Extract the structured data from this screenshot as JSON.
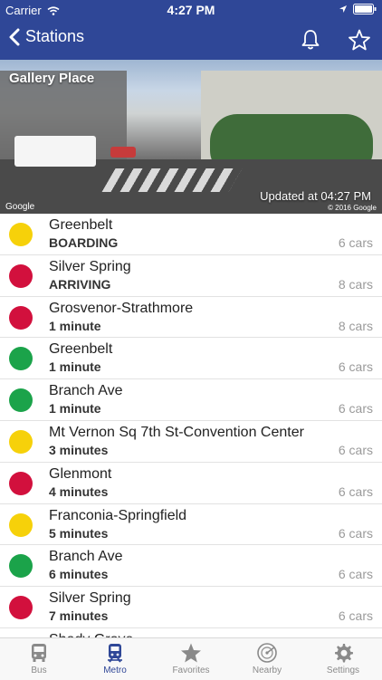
{
  "status_bar": {
    "carrier": "Carrier",
    "time": "4:27 PM",
    "location_icon": "location-arrow-icon",
    "battery_icon": "battery-icon",
    "wifi_icon": "wifi-icon"
  },
  "nav": {
    "back_label": "Stations",
    "back_icon": "chevron-left-icon",
    "bell_icon": "bell-icon",
    "star_icon": "star-icon",
    "bar_color": "#2f4797"
  },
  "banner": {
    "station": "Gallery Place",
    "updated": "Updated at 04:27 PM",
    "google": "Google",
    "copyright": "© 2016 Google"
  },
  "colors": {
    "yellow": "#f6d10a",
    "red": "#d2103d",
    "green": "#1ba34a"
  },
  "arrivals": [
    {
      "destination": "Greenbelt",
      "eta": "BOARDING",
      "cars": "6 cars",
      "line_color": "#f6d10a"
    },
    {
      "destination": "Silver Spring",
      "eta": "ARRIVING",
      "cars": "8 cars",
      "line_color": "#d2103d"
    },
    {
      "destination": "Grosvenor-Strathmore",
      "eta": "1 minute",
      "cars": "8 cars",
      "line_color": "#d2103d"
    },
    {
      "destination": "Greenbelt",
      "eta": "1 minute",
      "cars": "6 cars",
      "line_color": "#1ba34a"
    },
    {
      "destination": "Branch Ave",
      "eta": "1 minute",
      "cars": "6 cars",
      "line_color": "#1ba34a"
    },
    {
      "destination": "Mt Vernon Sq 7th St-Convention Center",
      "eta": "3 minutes",
      "cars": "6 cars",
      "line_color": "#f6d10a"
    },
    {
      "destination": "Glenmont",
      "eta": "4 minutes",
      "cars": "6 cars",
      "line_color": "#d2103d"
    },
    {
      "destination": "Franconia-Springfield",
      "eta": "5 minutes",
      "cars": "6 cars",
      "line_color": "#f6d10a"
    },
    {
      "destination": "Branch Ave",
      "eta": "6 minutes",
      "cars": "6 cars",
      "line_color": "#1ba34a"
    },
    {
      "destination": "Silver Spring",
      "eta": "7 minutes",
      "cars": "6 cars",
      "line_color": "#d2103d"
    },
    {
      "destination": "Shady Grove",
      "eta": "",
      "cars": "",
      "line_color": "#d2103d"
    }
  ],
  "tabs": [
    {
      "label": "Bus",
      "icon": "bus-icon",
      "active": false
    },
    {
      "label": "Metro",
      "icon": "train-icon",
      "active": true
    },
    {
      "label": "Favorites",
      "icon": "star-icon",
      "active": false
    },
    {
      "label": "Nearby",
      "icon": "radar-icon",
      "active": false
    },
    {
      "label": "Settings",
      "icon": "gear-icon",
      "active": false
    }
  ]
}
